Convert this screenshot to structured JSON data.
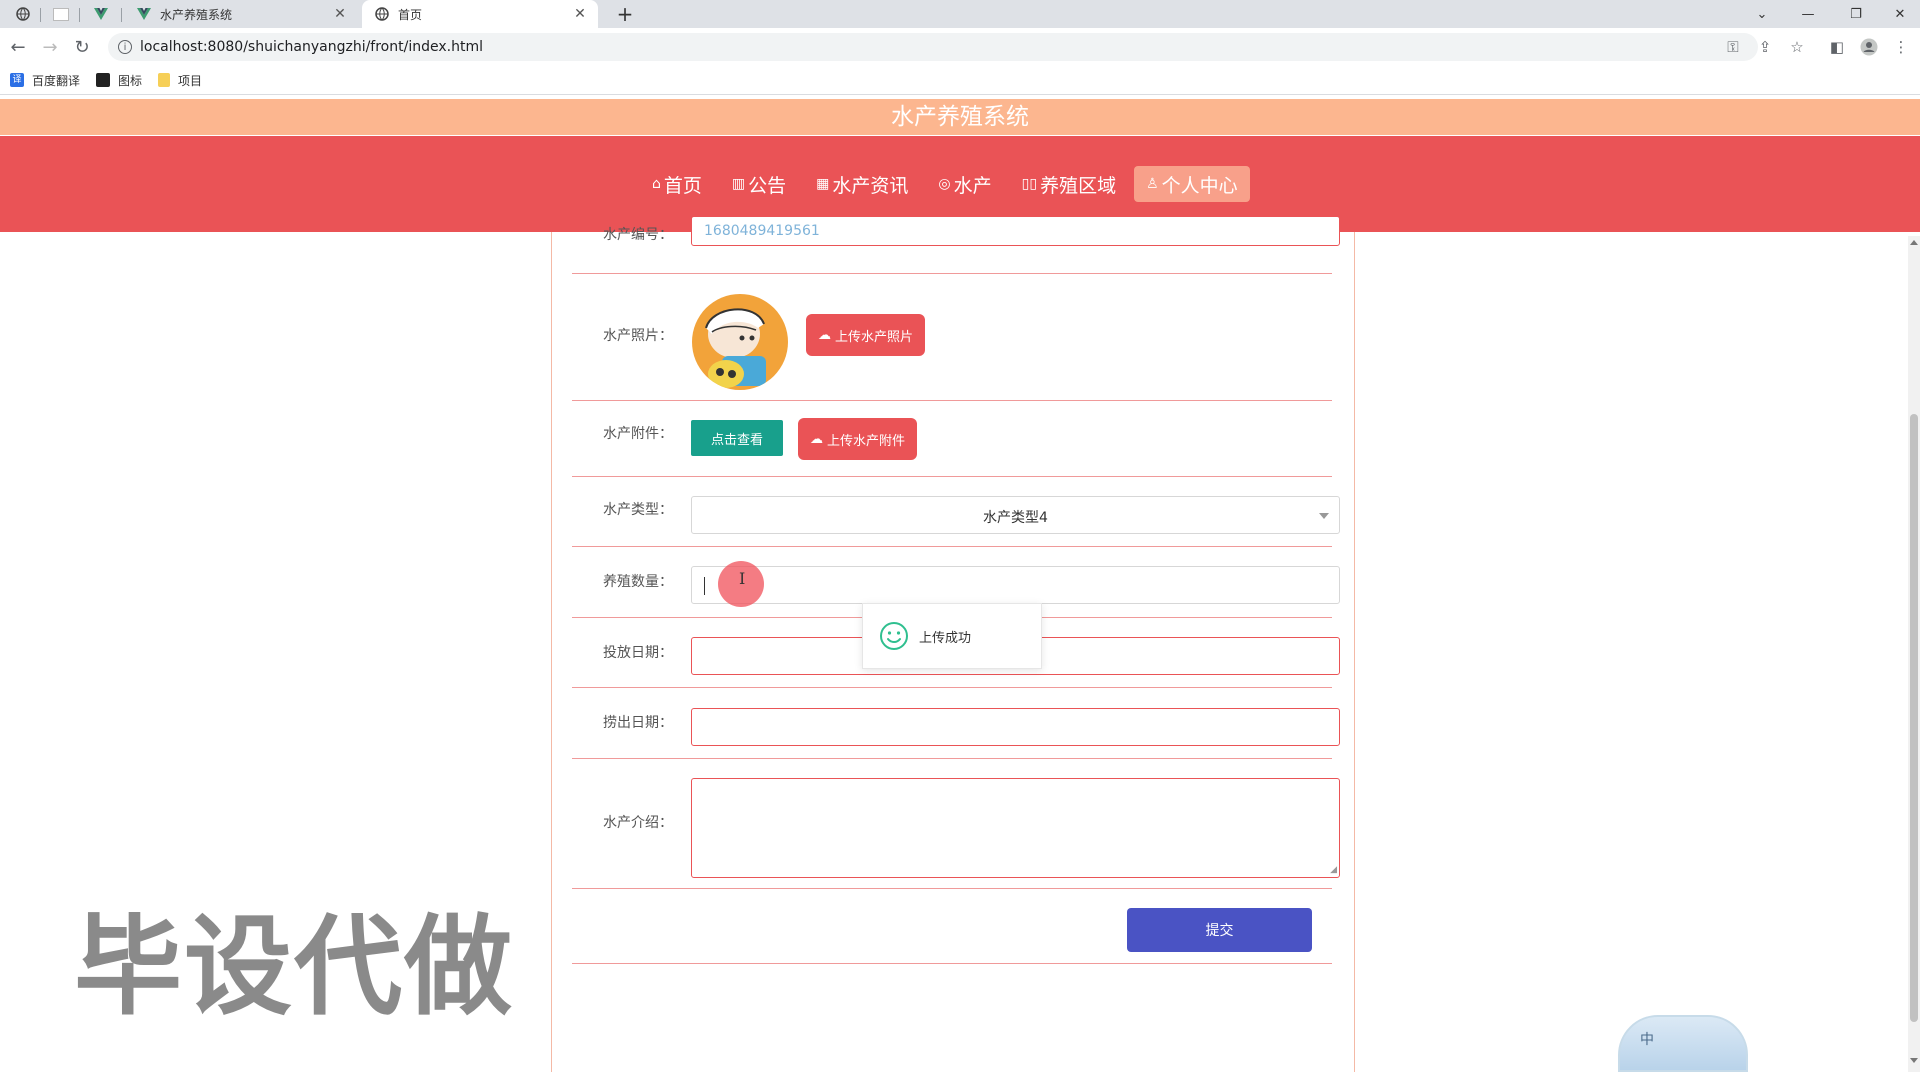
{
  "browser": {
    "tabs": [
      {
        "title": "水产养殖系统",
        "active": false
      },
      {
        "title": "首页",
        "active": true
      }
    ],
    "new_tab_label": "+",
    "url": "localhost:8080/shuichanyangzhi/front/index.html",
    "bookmarks": [
      {
        "label": "百度翻译",
        "icon": "translate-icon"
      },
      {
        "label": "图标",
        "icon": "image-icon"
      },
      {
        "label": "项目",
        "icon": "folder-icon"
      }
    ]
  },
  "site": {
    "title": "水产养殖系统",
    "nav": [
      {
        "label": "首页",
        "icon": "home-icon"
      },
      {
        "label": "公告",
        "icon": "notice-icon"
      },
      {
        "label": "水产资讯",
        "icon": "news-icon"
      },
      {
        "label": "水产",
        "icon": "fish-icon"
      },
      {
        "label": "养殖区域",
        "icon": "area-icon"
      },
      {
        "label": "个人中心",
        "icon": "user-icon",
        "active": true
      }
    ]
  },
  "form": {
    "code_label": "水产编号：",
    "code_value": "1680489419561",
    "photo_label": "水产照片：",
    "upload_photo_button": "上传水产照片",
    "attachment_label": "水产附件：",
    "view_button": "点击查看",
    "upload_attachment_button": "上传水产附件",
    "type_label": "水产类型：",
    "type_value": "水产类型4",
    "quantity_label": "养殖数量：",
    "release_date_label": "投放日期：",
    "harvest_date_label": "捞出日期：",
    "intro_label": "水产介绍：",
    "submit_button": "提交"
  },
  "toast": {
    "message": "上传成功"
  },
  "overlay": {
    "watermark": "毕设代做",
    "ime_label": "中"
  },
  "colors": {
    "primary": "#ea5356",
    "header": "#fcb68f",
    "teal": "#18a08c",
    "submit": "#4a53c4"
  }
}
